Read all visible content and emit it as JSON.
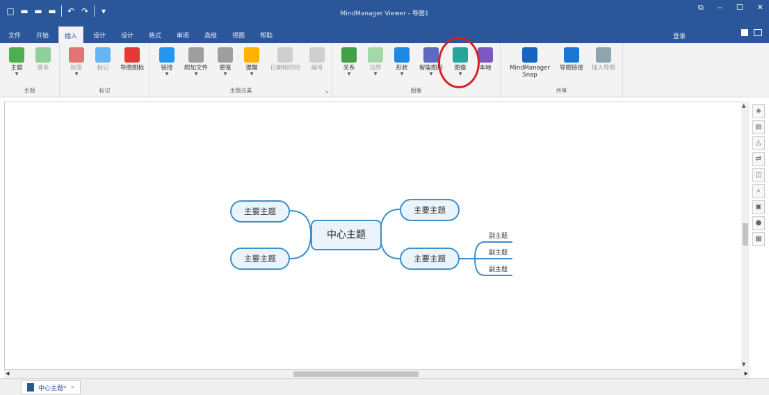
{
  "window": {
    "title": "MindManager Viewer - 导图1",
    "controls": {
      "restore": "⧉",
      "minimize": "‒",
      "maximize": "☐",
      "close": "✕"
    }
  },
  "qat": {
    "new_icon": "□",
    "open_icon": "▬",
    "save_icon": "▬",
    "print_icon": "▬",
    "undo_icon": "↶",
    "redo_icon": "↷",
    "customize_icon": "▾"
  },
  "tabs": [
    {
      "label": "文件"
    },
    {
      "label": "开始"
    },
    {
      "label": "插入"
    },
    {
      "label": "设计"
    },
    {
      "label": "设计"
    },
    {
      "label": "格式"
    },
    {
      "label": "审阅"
    },
    {
      "label": "高级"
    },
    {
      "label": "视图"
    },
    {
      "label": "帮助"
    }
  ],
  "signin": "登录",
  "ribbon": {
    "groups": [
      {
        "label": "主题"
      },
      {
        "label": "标记"
      },
      {
        "label": "主题元素"
      },
      {
        "label": "图像"
      },
      {
        "label": "共享"
      }
    ],
    "buttons": [
      {
        "label": "主题",
        "disabled": false,
        "color": "#4caf50"
      },
      {
        "label": "联系",
        "disabled": true,
        "color": "#8fcf9a"
      },
      {
        "label": "标签",
        "disabled": true,
        "color": "#e57373"
      },
      {
        "label": "标记",
        "disabled": true,
        "color": "#64b5f6"
      },
      {
        "label": "导图图标",
        "disabled": false,
        "color": "#e53935"
      },
      {
        "label": "链接",
        "disabled": false,
        "color": "#2196f3"
      },
      {
        "label": "附加文件",
        "disabled": false,
        "color": "#9e9e9e"
      },
      {
        "label": "便笺",
        "disabled": false,
        "color": "#9e9e9e"
      },
      {
        "label": "提醒",
        "disabled": false,
        "color": "#ffb300"
      },
      {
        "label": "日期和时间",
        "disabled": true,
        "color": "#cfcfcf"
      },
      {
        "label": "编号",
        "disabled": true,
        "color": "#cfcfcf"
      },
      {
        "label": "关系",
        "disabled": false,
        "color": "#43a047"
      },
      {
        "label": "边界",
        "disabled": true,
        "color": "#a5d6a7"
      },
      {
        "label": "形状",
        "disabled": false,
        "color": "#1e88e5"
      },
      {
        "label": "智能图形",
        "disabled": false,
        "color": "#5c6bc0"
      },
      {
        "label": "图像",
        "disabled": false,
        "color": "#26a69a"
      },
      {
        "label": "本地",
        "disabled": false,
        "color": "#7e57c2"
      },
      {
        "label": "MindManager Snap",
        "disabled": false,
        "color": "#1565c0"
      },
      {
        "label": "导图链接",
        "disabled": false,
        "color": "#1976d2"
      },
      {
        "label": "插入导图",
        "disabled": true,
        "color": "#90a4ae"
      }
    ]
  },
  "map": {
    "central_topic": "中心主题",
    "main_topics": [
      "主要主题",
      "主要主题",
      "主要主题",
      "主要主题"
    ],
    "subtopics": [
      "副主题",
      "副主题",
      "副主题"
    ]
  },
  "sheet_tab": {
    "label": "中心主题*",
    "close_icon": "×"
  },
  "colors": {
    "accent": "#2b579a",
    "topic_border": "#3d90cc",
    "highlight_circle": "#d62020"
  }
}
